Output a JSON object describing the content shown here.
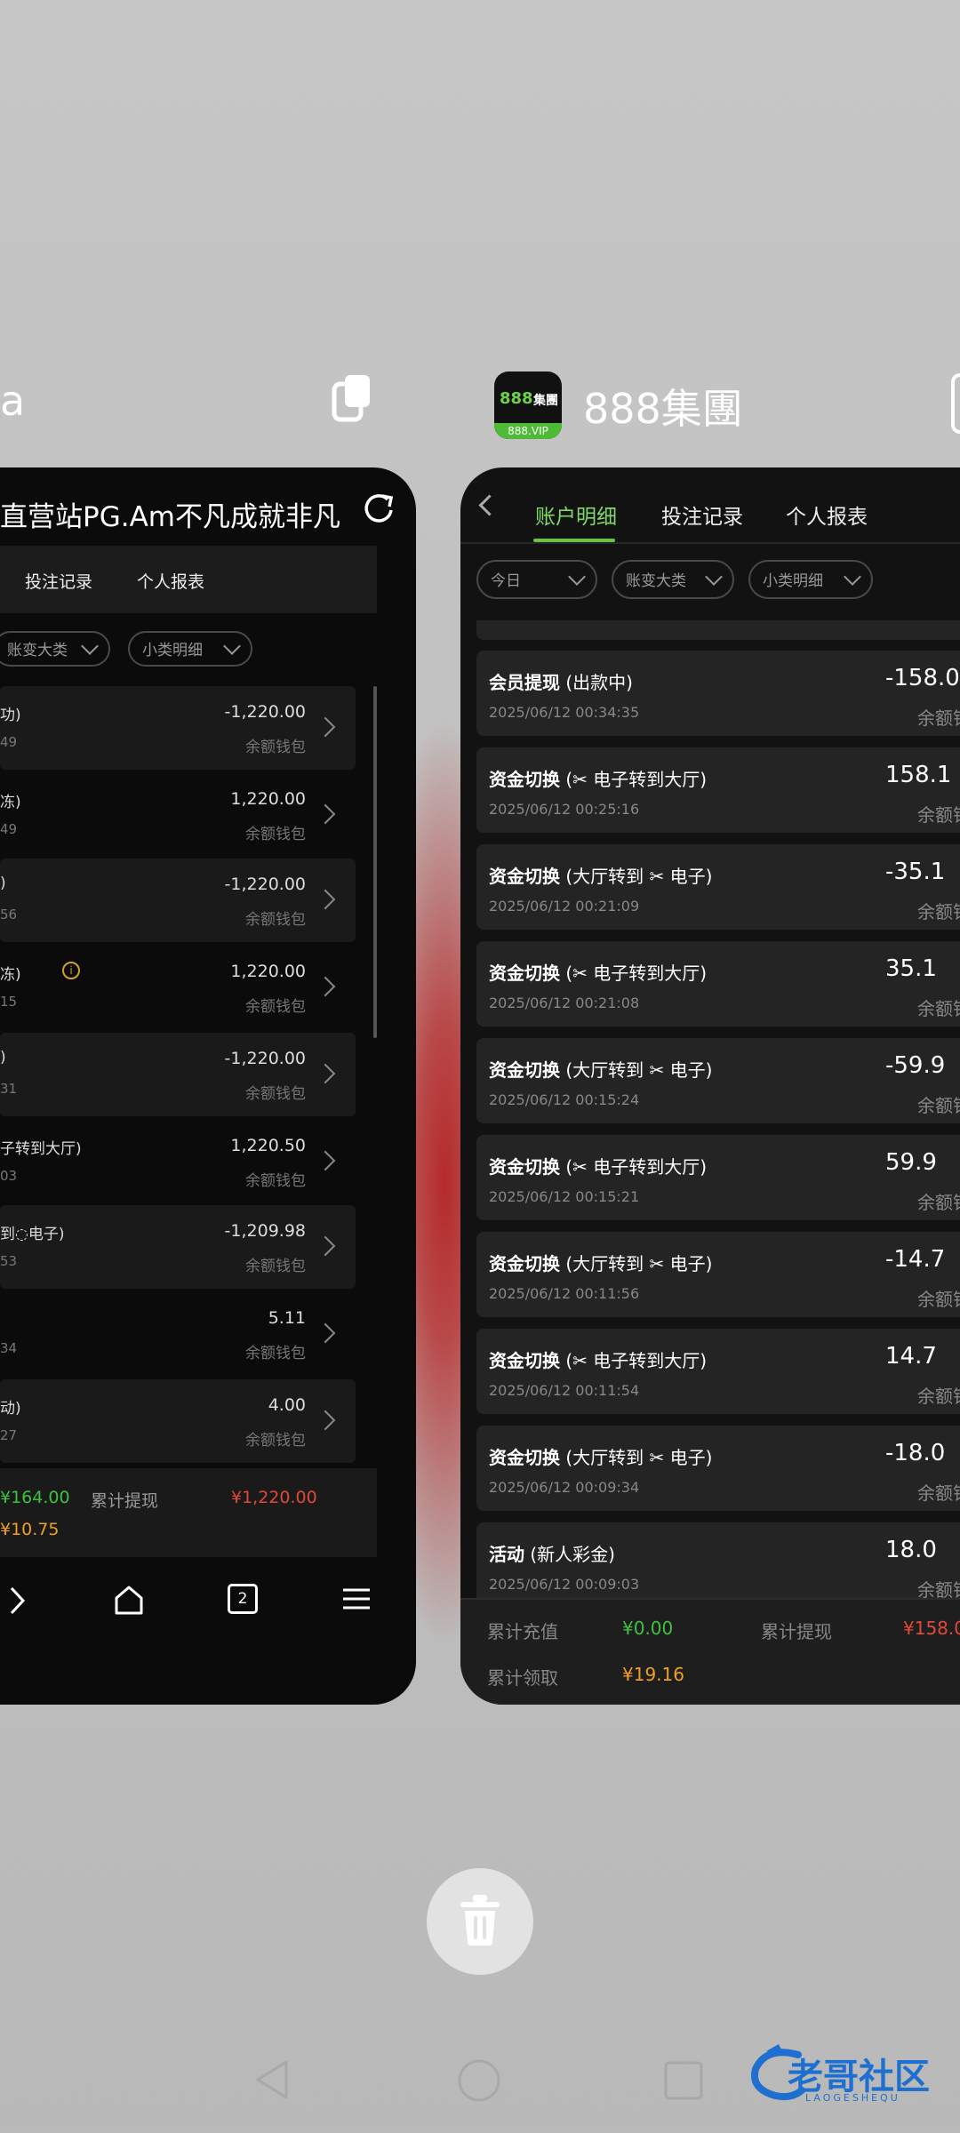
{
  "left_app": {
    "title_fragment": "a",
    "page_title": "直营站PG.Am不凡成就非凡",
    "tabs": [
      "投注记录",
      "个人报表"
    ],
    "filters": [
      "账变大类",
      "小类明细"
    ],
    "rows": [
      {
        "type": "功)",
        "time": "49",
        "amount": "-1,220.00",
        "wallet": "余额钱包"
      },
      {
        "type": "冻)",
        "time": "49",
        "amount": "1,220.00",
        "wallet": "余额钱包"
      },
      {
        "type": ")",
        "time": "56",
        "amount": "-1,220.00",
        "wallet": "余额钱包"
      },
      {
        "type": "冻)",
        "time": "15",
        "amount": "1,220.00",
        "wallet": "余额钱包"
      },
      {
        "type": ")",
        "time": "31",
        "amount": "-1,220.00",
        "wallet": "余额钱包"
      },
      {
        "type": "子转到大厅)",
        "time": "03",
        "amount": "1,220.50",
        "wallet": "余额钱包"
      },
      {
        "type": "到◌电子)",
        "time": "53",
        "amount": "-1,209.98",
        "wallet": "余额钱包"
      },
      {
        "type": "",
        "time": "34",
        "amount": "5.11",
        "wallet": "余额钱包"
      },
      {
        "type": "动)",
        "time": "27",
        "amount": "4.00",
        "wallet": "余额钱包"
      }
    ],
    "footer": {
      "recharge_value": "¥164.00",
      "withdraw_label": "累计提现",
      "withdraw_value": "¥1,220.00",
      "claim_value": "¥10.75"
    },
    "nav": {
      "tab_count": "2"
    }
  },
  "right_app": {
    "app_name": "888集團",
    "icon_text": "888",
    "icon_cn": "集團",
    "icon_vip": "888.VIP",
    "tabs": [
      "账户明细",
      "投注记录",
      "个人报表"
    ],
    "filters": [
      "今日",
      "账变大类",
      "小类明细"
    ],
    "rows": [
      {
        "type": "会员提现",
        "detail": "(出款中)",
        "time": "2025/06/12 00:34:35",
        "amount": "-158.0",
        "wallet": "余额钱包"
      },
      {
        "type": "资金切换",
        "detail": "(✂ 电子转到大厅)",
        "time": "2025/06/12 00:25:16",
        "amount": "158.1",
        "wallet": "余额钱包"
      },
      {
        "type": "资金切换",
        "detail": "(大厅转到 ✂ 电子)",
        "time": "2025/06/12 00:21:09",
        "amount": "-35.1",
        "wallet": "余额钱包"
      },
      {
        "type": "资金切换",
        "detail": "(✂ 电子转到大厅)",
        "time": "2025/06/12 00:21:08",
        "amount": "35.1",
        "wallet": "余额钱包"
      },
      {
        "type": "资金切换",
        "detail": "(大厅转到 ✂ 电子)",
        "time": "2025/06/12 00:15:24",
        "amount": "-59.9",
        "wallet": "余额钱包"
      },
      {
        "type": "资金切换",
        "detail": "(✂ 电子转到大厅)",
        "time": "2025/06/12 00:15:21",
        "amount": "59.9",
        "wallet": "余额钱包"
      },
      {
        "type": "资金切换",
        "detail": "(大厅转到 ✂ 电子)",
        "time": "2025/06/12 00:11:56",
        "amount": "-14.7",
        "wallet": "余额钱包"
      },
      {
        "type": "资金切换",
        "detail": "(✂ 电子转到大厅)",
        "time": "2025/06/12 00:11:54",
        "amount": "14.7",
        "wallet": "余额钱包"
      },
      {
        "type": "资金切换",
        "detail": "(大厅转到 ✂ 电子)",
        "time": "2025/06/12 00:09:34",
        "amount": "-18.0",
        "wallet": "余额钱包"
      },
      {
        "type": "活动",
        "detail": "(新人彩金)",
        "time": "2025/06/12 00:09:03",
        "amount": "18.0",
        "wallet": "余额钱包"
      }
    ],
    "footer": {
      "recharge_label": "累计充值",
      "recharge_value": "¥0.00",
      "withdraw_label": "累计提现",
      "withdraw_value": "¥158.0",
      "claim_label": "累计领取",
      "claim_value": "¥19.16"
    }
  },
  "watermark": {
    "title": "老哥社区",
    "sub": "LAOGESHEQU"
  },
  "colors": {
    "green": "#3ec13e",
    "red": "#e0493a",
    "orange": "#f0a020",
    "accent": "#7fd86a"
  }
}
